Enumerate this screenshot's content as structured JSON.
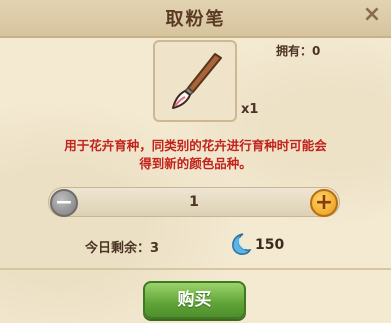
{
  "dialog": {
    "title": "取粉笔",
    "close_icon": "close-icon"
  },
  "item": {
    "icon": "brush-icon",
    "quantity_label": "x1",
    "owned_text": "拥有：0"
  },
  "description": {
    "line1": "用于花卉育种，同类别的花卉进行育种时可能会",
    "line2": "得到新的颜色品种。"
  },
  "stepper": {
    "value": "1",
    "minus_label": "−",
    "plus_label": "+"
  },
  "purchase": {
    "remaining_text": "今日剩余：3",
    "currency_icon": "moon-icon",
    "price": "150",
    "buy_label": "购买"
  },
  "colors": {
    "description_text": "#c2231b",
    "buy_button": "#5fa437",
    "plus_button": "#e99a17"
  }
}
